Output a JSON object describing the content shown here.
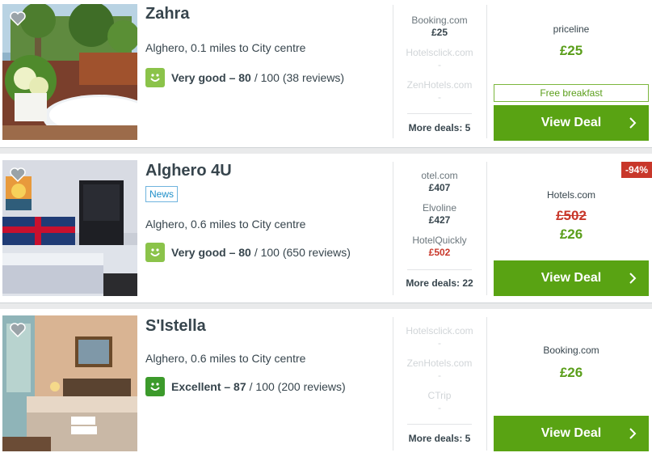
{
  "hotels": [
    {
      "name": "Zahra",
      "location": "Alghero, 0.1 miles to City centre",
      "rating": {
        "label": "Very good – 80",
        "rest": "/ 100 (38 reviews)",
        "color": "#8bc34a"
      },
      "deals": [
        {
          "provider": "Booking.com",
          "price": "£25",
          "muted": false
        },
        {
          "provider": "Hotelsclick.com",
          "price": "-",
          "muted": true
        },
        {
          "provider": "ZenHotels.com",
          "price": "-",
          "muted": true
        }
      ],
      "more_deals": "More deals: 5",
      "offer": {
        "provider": "priceline",
        "price": "£25",
        "perk": "Free breakfast",
        "cta": "View Deal"
      }
    },
    {
      "name": "Alghero 4U",
      "badge": "News",
      "discount": "-94%",
      "location": "Alghero, 0.6 miles to City centre",
      "rating": {
        "label": "Very good – 80",
        "rest": "/ 100 (650 reviews)",
        "color": "#8bc34a"
      },
      "deals": [
        {
          "provider": "otel.com",
          "price": "£407",
          "muted": false
        },
        {
          "provider": "Elvoline",
          "price": "£427",
          "muted": false
        },
        {
          "provider": "HotelQuickly",
          "price": "£502",
          "muted": false,
          "red": true
        }
      ],
      "more_deals": "More deals: 22",
      "offer": {
        "provider": "Hotels.com",
        "old_price": "£502",
        "price": "£26",
        "cta": "View Deal"
      }
    },
    {
      "name": "S'Istella",
      "location": "Alghero, 0.6 miles to City centre",
      "rating": {
        "label": "Excellent – 87",
        "rest": "/ 100 (200 reviews)",
        "color": "#3c9a2b"
      },
      "deals": [
        {
          "provider": "Hotelsclick.com",
          "price": "-",
          "muted": true
        },
        {
          "provider": "ZenHotels.com",
          "price": "-",
          "muted": true
        },
        {
          "provider": "CTrip",
          "price": "-",
          "muted": true
        }
      ],
      "more_deals": "More deals: 5",
      "offer": {
        "provider": "Booking.com",
        "price": "£26",
        "cta": "View Deal"
      }
    }
  ],
  "icons": {
    "favorite": "heart-icon",
    "rating": "smiley-icon",
    "cta": "chevron-right-icon"
  },
  "colors": {
    "cta": "#59a313",
    "price": "#5a9e1a",
    "discount": "#c8372a",
    "badge": "#1f8fc9"
  }
}
